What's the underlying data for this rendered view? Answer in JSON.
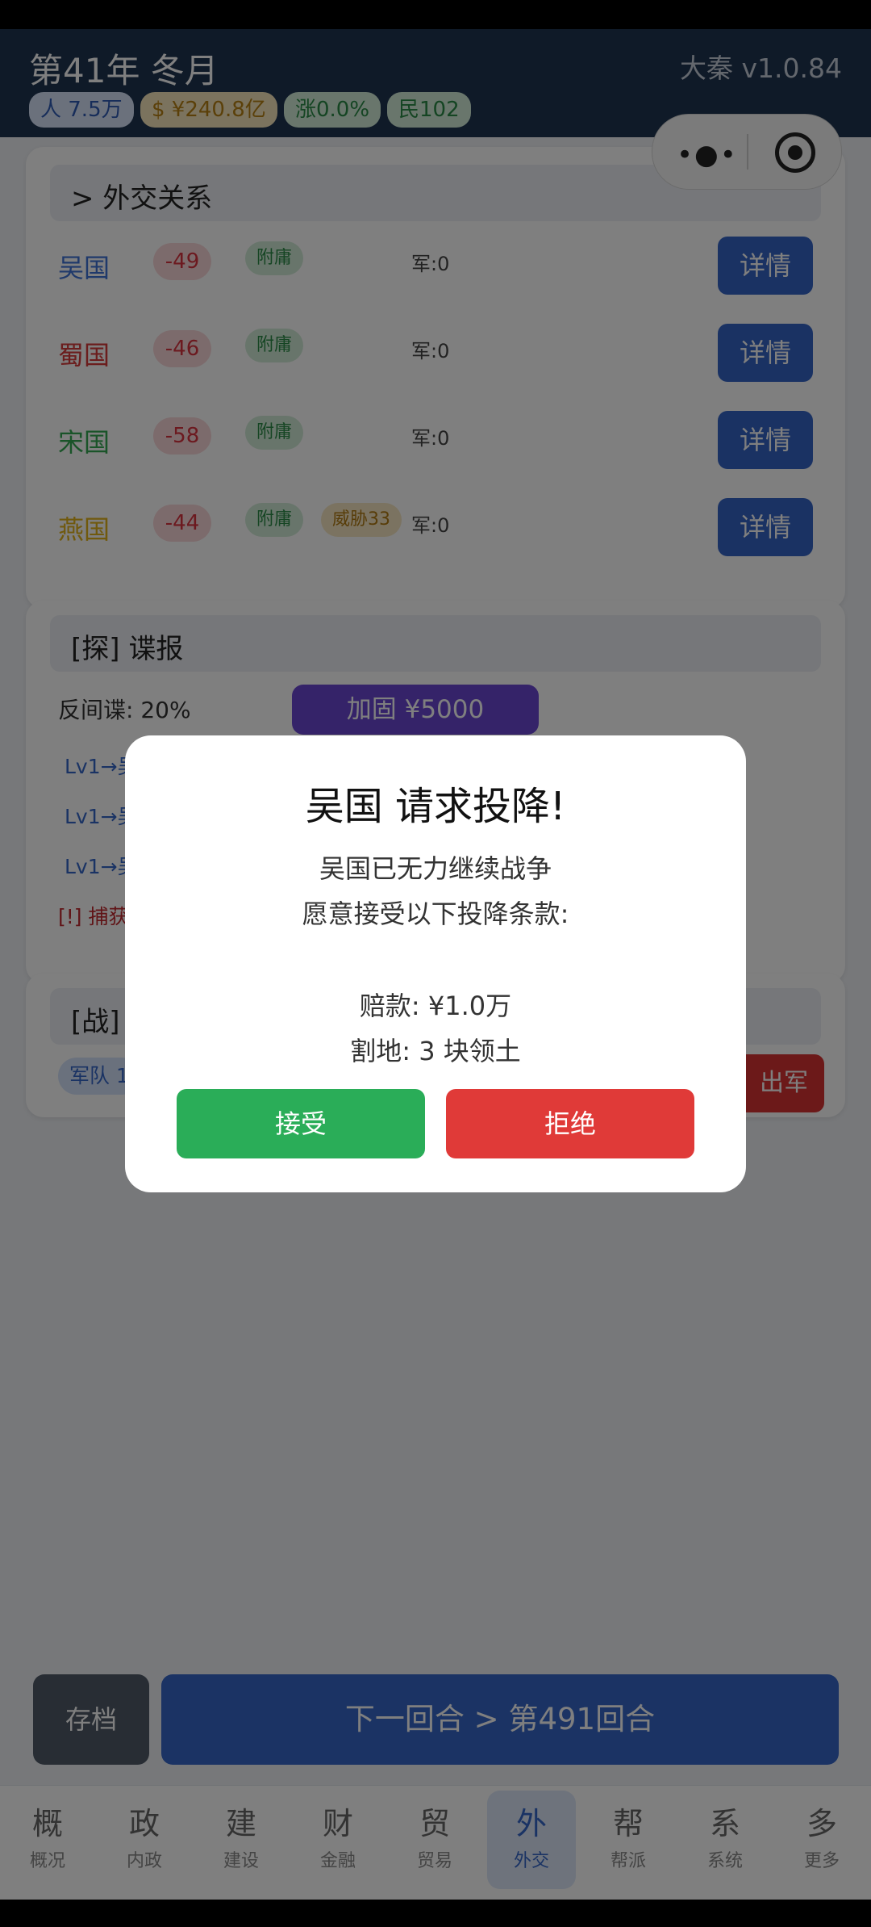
{
  "header": {
    "title": "第41年 冬月",
    "version": "大秦  v1.0.84",
    "stats": [
      {
        "label": "人 7.5万",
        "color": "#2f5bb5",
        "bg": "#d7e3f8"
      },
      {
        "label": "$ ¥240.8亿",
        "color": "#b78012",
        "bg": "#f7e6bd"
      },
      {
        "label": "涨0.0%",
        "color": "#2b8a46",
        "bg": "#d2ecd9"
      },
      {
        "label": "民102",
        "color": "#2b8a46",
        "bg": "#d2ecd9"
      }
    ]
  },
  "diplomacy": {
    "heading": ">  外交关系",
    "countries": [
      {
        "name": "吴国",
        "color": "#3f73d6",
        "relation": "-49",
        "status": "附庸",
        "threat": "",
        "army": "军:0",
        "button": "详情"
      },
      {
        "name": "蜀国",
        "color": "#d63a3a",
        "relation": "-46",
        "status": "附庸",
        "threat": "",
        "army": "军:0",
        "button": "详情"
      },
      {
        "name": "宋国",
        "color": "#34a852",
        "relation": "-58",
        "status": "附庸",
        "threat": "",
        "army": "军:0",
        "button": "详情"
      },
      {
        "name": "燕国",
        "color": "#e0b21a",
        "relation": "-44",
        "status": "附庸",
        "threat": "威胁33",
        "army": "军:0",
        "button": "详情"
      }
    ]
  },
  "intel": {
    "heading": "[探]  谍报",
    "counter_spy": "反间谍: 20%",
    "reinforce_button": "加固 ¥5000",
    "lines": [
      "Lv1→吴",
      "Lv1→吴",
      "Lv1→吴"
    ],
    "warning": "[!] 捕获"
  },
  "war": {
    "heading": "[战]",
    "army_chip": "军队 1",
    "action_button": "出军"
  },
  "bottom": {
    "save": "存档",
    "next": "下一回合 > 第491回合"
  },
  "tabs": [
    {
      "icon": "概",
      "label": "概况",
      "active": false
    },
    {
      "icon": "政",
      "label": "内政",
      "active": false
    },
    {
      "icon": "建",
      "label": "建设",
      "active": false
    },
    {
      "icon": "财",
      "label": "金融",
      "active": false
    },
    {
      "icon": "贸",
      "label": "贸易",
      "active": false
    },
    {
      "icon": "外",
      "label": "外交",
      "active": true
    },
    {
      "icon": "帮",
      "label": "帮派",
      "active": false
    },
    {
      "icon": "系",
      "label": "系统",
      "active": false
    },
    {
      "icon": "多",
      "label": "更多",
      "active": false
    }
  ],
  "modal": {
    "title": "吴国 请求投降!",
    "line1": "吴国已无力继续战争",
    "line2": "愿意接受以下投降条款:",
    "indemnity": "赔款: ¥1.0万",
    "territory": "割地: 3 块领土",
    "accept": "接受",
    "reject": "拒绝"
  }
}
